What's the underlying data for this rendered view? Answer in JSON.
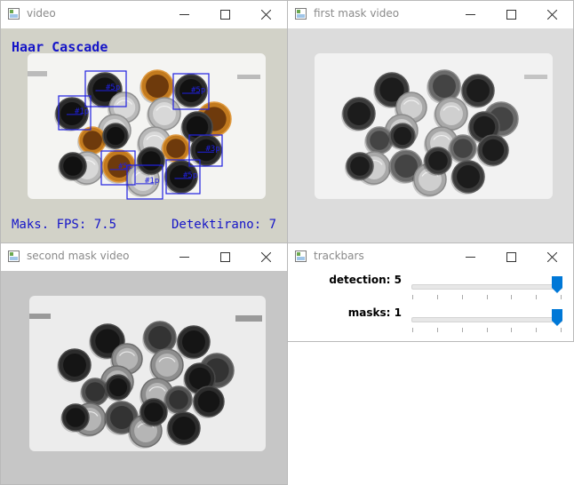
{
  "windows": {
    "video": {
      "title": "video",
      "overlay": {
        "heading": "Haar Cascade",
        "fps_text": "Maks. FPS: 7.5",
        "count_text": "Detektirano: 7"
      },
      "detections": [
        {
          "label": "#5p"
        },
        {
          "label": "#1p"
        },
        {
          "label": "#5p"
        },
        {
          "label": "#3p"
        },
        {
          "label": "#5p"
        },
        {
          "label": "#1p"
        },
        {
          "label": "#5p"
        }
      ]
    },
    "first_mask": {
      "title": "first mask video"
    },
    "second_mask": {
      "title": "second mask video"
    },
    "trackbars": {
      "title": "trackbars",
      "sliders": [
        {
          "label": "detection: 5",
          "value": 5,
          "max": 5
        },
        {
          "label": "masks: 1",
          "value": 1,
          "max": 1
        }
      ]
    }
  },
  "colors": {
    "overlay_text": "#1515c8",
    "detection_box": "#2020e0",
    "accent": "#0078d7"
  },
  "icons": [
    "app-icon",
    "minimize-icon",
    "maximize-icon",
    "close-icon"
  ]
}
